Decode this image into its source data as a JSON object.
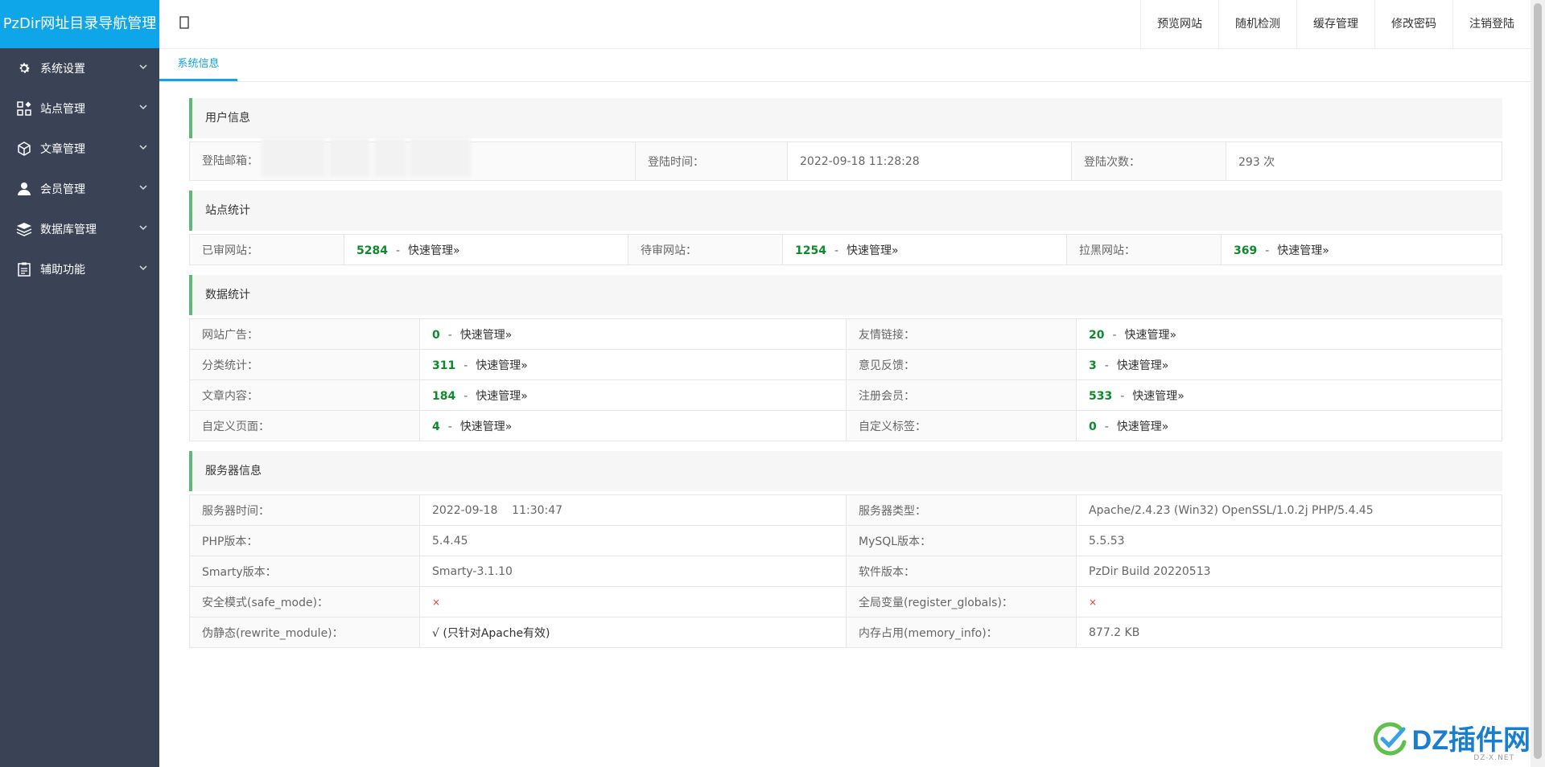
{
  "app": {
    "brand": "PzDir网址目录导航管理"
  },
  "sidebar": {
    "items": [
      {
        "label": "系统设置",
        "icon": "gear-icon"
      },
      {
        "label": "站点管理",
        "icon": "apps-icon"
      },
      {
        "label": "文章管理",
        "icon": "cube-icon"
      },
      {
        "label": "会员管理",
        "icon": "user-icon"
      },
      {
        "label": "数据库管理",
        "icon": "database-icon"
      },
      {
        "label": "辅助功能",
        "icon": "clipboard-icon"
      }
    ]
  },
  "topnav": {
    "toggle_glyph": "▯",
    "links": [
      "预览网站",
      "随机检测",
      "缓存管理",
      "修改密码",
      "注销登陆"
    ]
  },
  "tabs": {
    "active": "系统信息"
  },
  "common": {
    "quick_link": "快速管理»",
    "dash": "-"
  },
  "user_info": {
    "title": "用户信息",
    "email_label": "登陆邮箱：",
    "time_label": "登陆时间：",
    "time_value": "2022-09-18 11:28:28",
    "count_label": "登陆次数：",
    "count_value": "293 次"
  },
  "site_stats": {
    "title": "站点统计",
    "approved_label": "已审网站：",
    "approved_value": "5284",
    "pending_label": "待审网站：",
    "pending_value": "1254",
    "blacklist_label": "拉黑网站：",
    "blacklist_value": "369"
  },
  "data_stats": {
    "title": "数据统计",
    "rows": [
      {
        "l1": "网站广告：",
        "v1": "0",
        "l2": "友情链接：",
        "v2": "20"
      },
      {
        "l1": "分类统计：",
        "v1": "311",
        "l2": "意见反馈：",
        "v2": "3"
      },
      {
        "l1": "文章内容：",
        "v1": "184",
        "l2": "注册会员：",
        "v2": "533"
      },
      {
        "l1": "自定义页面：",
        "v1": "4",
        "l2": "自定义标签：",
        "v2": "0"
      }
    ]
  },
  "server_info": {
    "title": "服务器信息",
    "rows": [
      {
        "l1": "服务器时间：",
        "v1": "2022-09-18    11:30:47",
        "l2": "服务器类型：",
        "v2": "Apache/2.4.23 (Win32) OpenSSL/1.0.2j PHP/5.4.45"
      },
      {
        "l1": "PHP版本：",
        "v1": "5.4.45",
        "l2": "MySQL版本：",
        "v2": "5.5.53"
      },
      {
        "l1": "Smarty版本：",
        "v1": "Smarty-3.1.10",
        "l2": "软件版本：",
        "v2": "PzDir Build 20220513"
      },
      {
        "l1": "安全模式(safe_mode)：",
        "v1": "×",
        "l2": "全局变量(register_globals)：",
        "v2": "×"
      },
      {
        "l1": "伪静态(rewrite_module)：",
        "v1": "√ (只针对Apache有效)",
        "l2": "内存占用(memory_info)：",
        "v2": "877.2 KB"
      }
    ]
  },
  "watermark": {
    "text": "DZ插件网",
    "sub": "DZ-X.NET"
  },
  "colors": {
    "brand": "#0ea5e9",
    "sidebar": "#3a4356",
    "accent_green": "#5fb878",
    "number_green": "#0c8a2c",
    "x_red": "#e53935"
  }
}
